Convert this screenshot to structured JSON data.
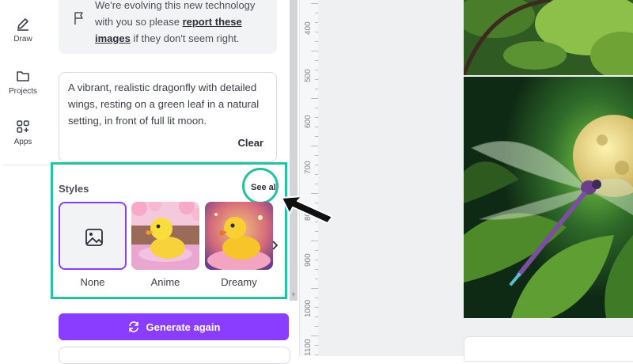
{
  "rail": {
    "items": [
      {
        "label": "Draw",
        "icon": "pen-icon"
      },
      {
        "label": "Projects",
        "icon": "folder-icon"
      },
      {
        "label": "Apps",
        "icon": "apps-icon"
      }
    ]
  },
  "notice": {
    "line1": "We're evolving this new technology",
    "line2_pre": "with you so please ",
    "link_part1": "report these",
    "link_part2": "images",
    "line3_post": " if they don't seem right."
  },
  "prompt": {
    "text": "A vibrant, realistic dragonfly with detailed wings, resting on a green leaf in a natural setting, in front of full lit moon.",
    "clear_label": "Clear"
  },
  "styles": {
    "title": "Styles",
    "see_all": "See all",
    "options": [
      {
        "label": "None",
        "selected": true
      },
      {
        "label": "Anime",
        "selected": false
      },
      {
        "label": "Dreamy",
        "selected": false
      }
    ]
  },
  "generate": {
    "label": "Generate again"
  },
  "ruler": {
    "labels": [
      "400",
      "500",
      "600",
      "700",
      "800",
      "900",
      "1000",
      "1100"
    ]
  },
  "colors": {
    "accent": "#8b3dff",
    "highlight": "#24c2a0"
  }
}
